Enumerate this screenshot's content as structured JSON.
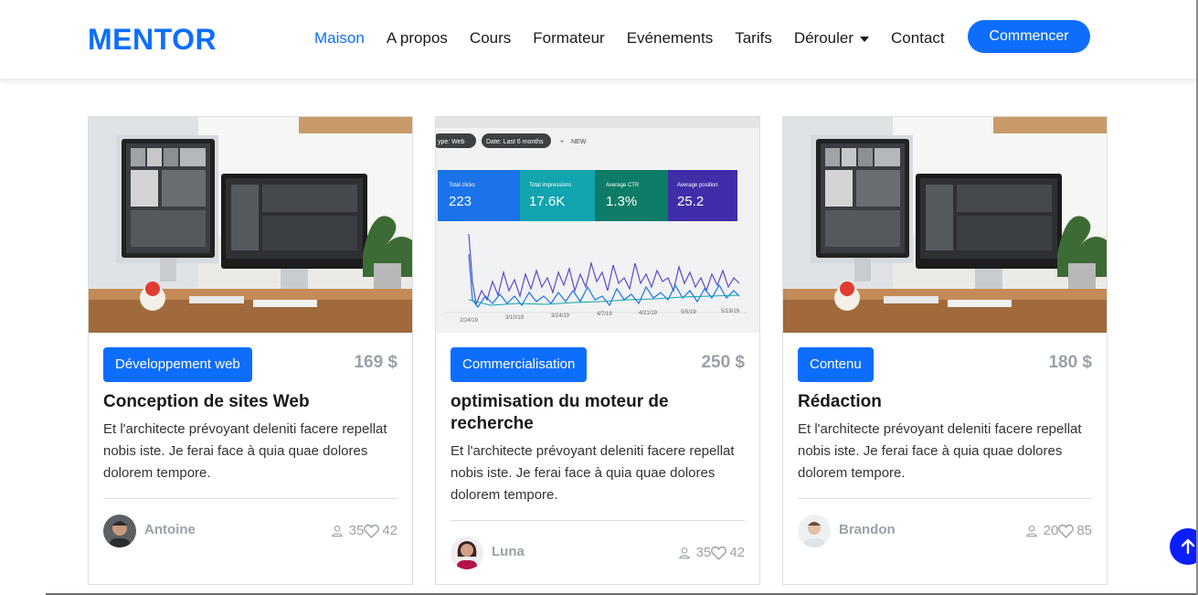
{
  "header": {
    "logo": "MENTOR",
    "nav": [
      {
        "label": "Maison",
        "active": true
      },
      {
        "label": "A propos"
      },
      {
        "label": "Cours"
      },
      {
        "label": "Formateur"
      },
      {
        "label": "Evénements"
      },
      {
        "label": "Tarifs"
      },
      {
        "label": "Dérouler"
      },
      {
        "label": "Contact"
      }
    ],
    "cta_label": "Commencer"
  },
  "courses": [
    {
      "category": "Développement web",
      "price": "169 $",
      "title": "Conception de sites Web",
      "description": "Et l'architecte prévoyant deleniti facere repellat nobis iste. Je ferai face à quia quae dolores dolorem tempore.",
      "author": "Antoine",
      "students": "35",
      "likes": "42"
    },
    {
      "category": "Commercialisation",
      "price": "250 $",
      "title": "optimisation du moteur de recherche",
      "description": "Et l'architecte prévoyant deleniti facere repellat nobis iste. Je ferai face à quia quae dolores dolorem tempore.",
      "author": "Luna",
      "students": "35",
      "likes": "42",
      "dashboard": {
        "chips": [
          "ype: Web",
          "Date: Last 6 months",
          "NEW"
        ],
        "metrics": [
          {
            "label": "Total clicks",
            "value": "223"
          },
          {
            "label": "Total impressions",
            "value": "17.6K"
          },
          {
            "label": "Average CTR",
            "value": "1.3%"
          },
          {
            "label": "Average position",
            "value": "25.2"
          }
        ],
        "dates": [
          "2/24/19",
          "3/10/19",
          "3/24/19",
          "4/7/19",
          "4/21/19",
          "5/5/19",
          "5/19/19"
        ]
      }
    },
    {
      "category": "Contenu",
      "price": "180 $",
      "title": "Rédaction",
      "description": "Et l'architecte prévoyant deleniti facere repellat nobis iste. Je ferai face à quia quae dolores dolorem tempore.",
      "author": "Brandon",
      "students": "20",
      "likes": "85"
    }
  ],
  "colors": {
    "accent": "#0d6efd",
    "muted": "#9aa1a8",
    "metric_blue": "#1a73e8",
    "metric_teal": "#12a4af",
    "metric_green": "#0d7c66",
    "metric_purple": "#5e35b1"
  },
  "icons": [
    "user-icon",
    "heart-icon",
    "arrow-up-icon"
  ]
}
